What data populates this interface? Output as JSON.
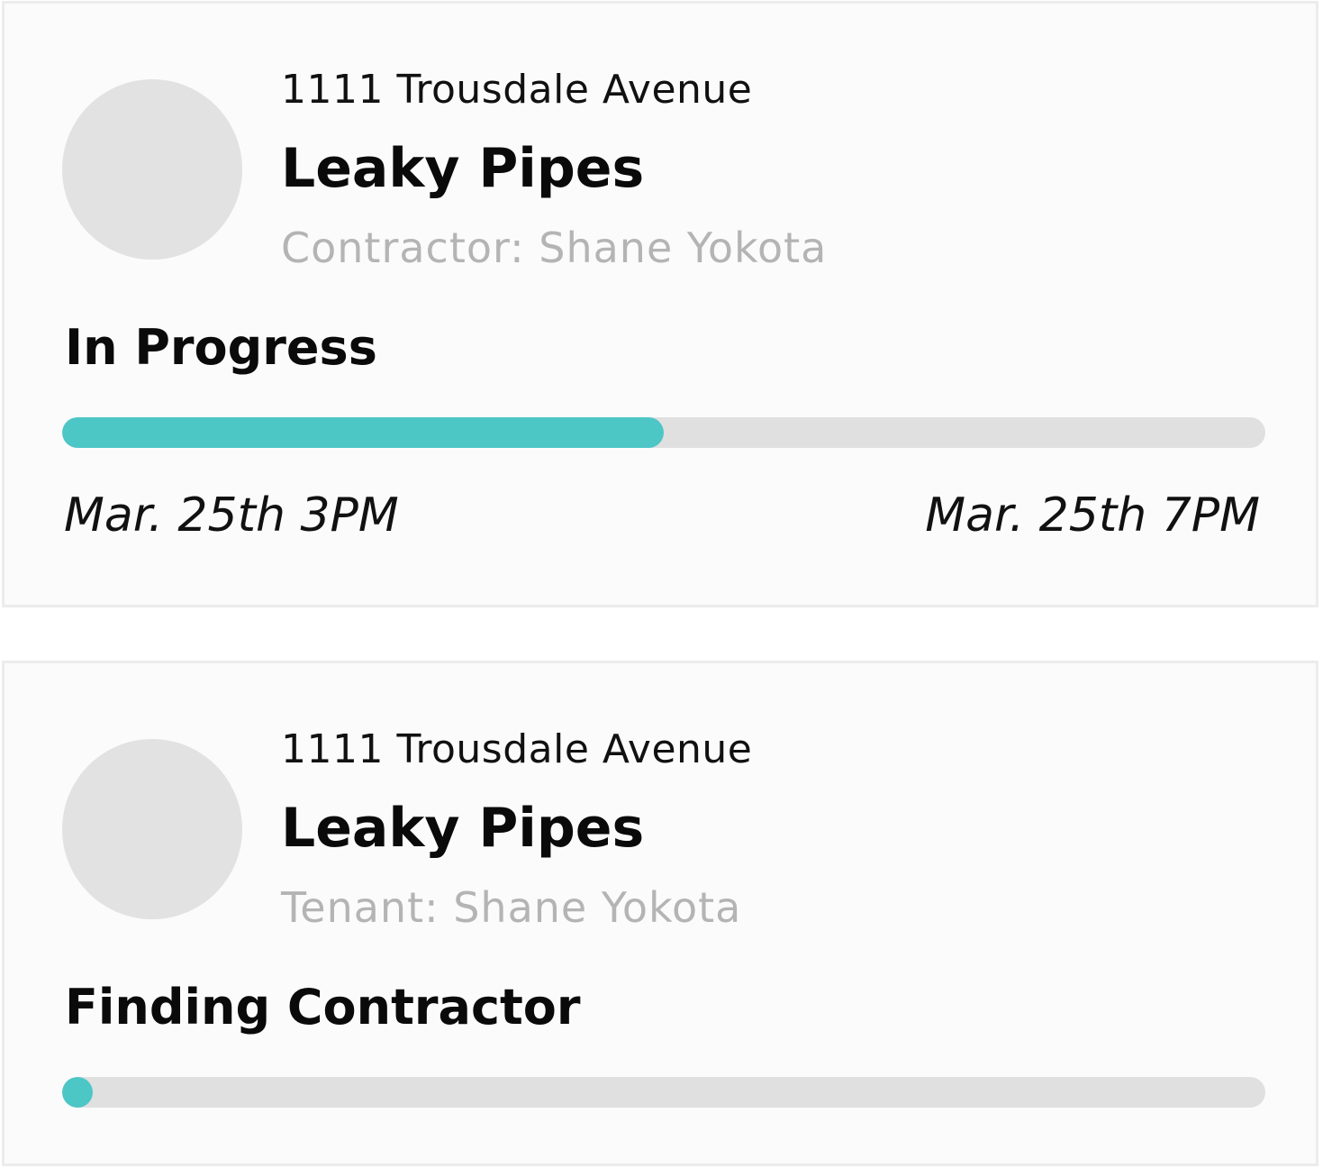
{
  "colors": {
    "accent": "#4dc6c6",
    "track": "#e0e0e0",
    "avatar_placeholder": "#e2e2e2",
    "muted_text": "#b4b4b4"
  },
  "cards": [
    {
      "address": "1111 Trousdale Avenue",
      "title": "Leaky Pipes",
      "person": "Contractor:  Shane Yokota",
      "status": "In Progress",
      "progress_fraction": 0.5,
      "start_time": "Mar. 25th 3PM",
      "end_time": "Mar. 25th 7PM"
    },
    {
      "address": "1111 Trousdale Avenue",
      "title": "Leaky Pipes",
      "person": "Tenant:  Shane Yokota",
      "status": "Finding Contractor",
      "progress_fraction": 0.0
    }
  ]
}
